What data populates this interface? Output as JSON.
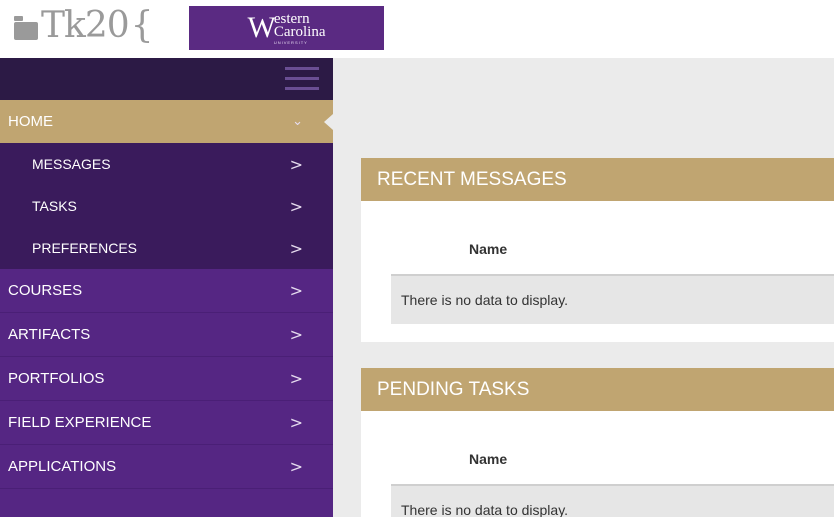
{
  "header": {
    "app_logo_text": "Tk20",
    "app_logo_brace": "{",
    "university_logo": {
      "mark": "W",
      "line1": "estern",
      "line2": "Carolina",
      "line3": "UNIVERSITY"
    }
  },
  "sidebar": {
    "menu_icon": "hamburger-icon",
    "home": {
      "label": "HOME",
      "chevron": "⌄"
    },
    "home_subitems": [
      {
        "label": "MESSAGES",
        "chevron": ">"
      },
      {
        "label": "TASKS",
        "chevron": ">"
      },
      {
        "label": "PREFERENCES",
        "chevron": ">"
      }
    ],
    "items": [
      {
        "label": "COURSES",
        "chevron": ">"
      },
      {
        "label": "ARTIFACTS",
        "chevron": ">"
      },
      {
        "label": "PORTFOLIOS",
        "chevron": ">"
      },
      {
        "label": "FIELD EXPERIENCE",
        "chevron": ">"
      },
      {
        "label": "APPLICATIONS",
        "chevron": ">"
      }
    ]
  },
  "main": {
    "panels": [
      {
        "title": "RECENT MESSAGES",
        "column_header": "Name",
        "empty_text": "There is no data to display."
      },
      {
        "title": "PENDING TASKS",
        "column_header": "Name",
        "empty_text": "There is no data to display."
      }
    ]
  },
  "colors": {
    "sidebar_purple": "#552683",
    "sidebar_dark": "#2c1a45",
    "gold": "#c0a571",
    "content_bg": "#ebebeb"
  }
}
